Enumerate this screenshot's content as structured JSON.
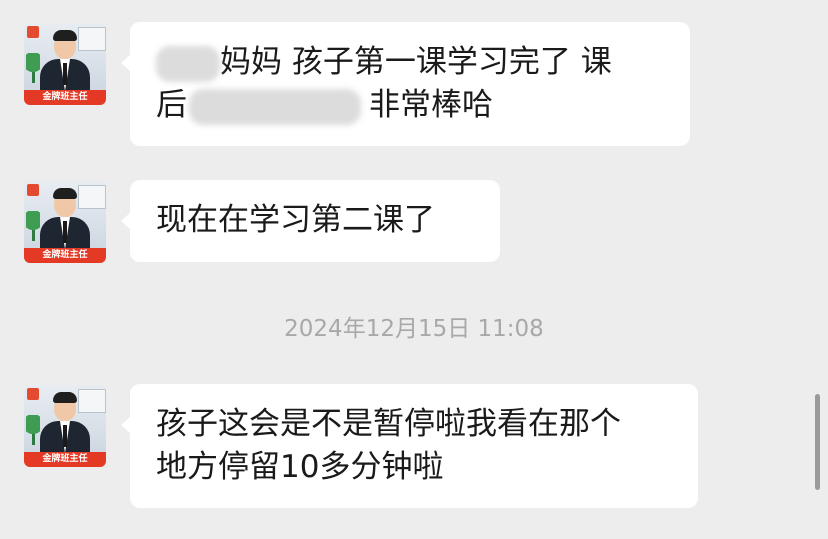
{
  "messages": [
    {
      "sender_badge": "金牌班主任",
      "line1_text": "妈妈  孩子第一课学习完了 课",
      "line2_prefix": "后",
      "line2_suffix": "非常棒哈"
    },
    {
      "sender_badge": "金牌班主任",
      "line1_text": "现在在学习第二课了"
    },
    {
      "sender_badge": "金牌班主任",
      "line1_text": "孩子这会是不是暂停啦我看在那个",
      "line2_text": "地方停留10多分钟啦"
    }
  ],
  "timestamp": "2024年12月15日 11:08",
  "colors": {
    "background": "#ededed",
    "bubble": "#ffffff",
    "badge": "#e43a25",
    "timestamp": "#a8a8a8"
  }
}
